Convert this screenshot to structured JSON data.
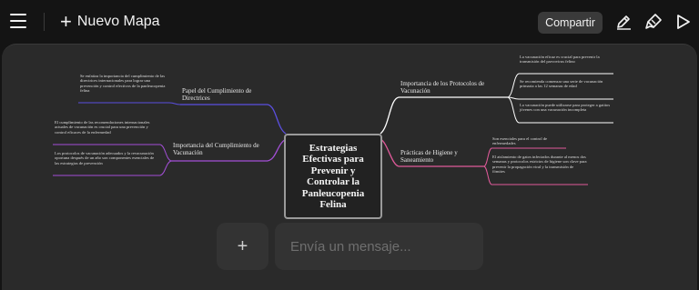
{
  "header": {
    "menu_icon": "hamburger-icon",
    "new_map_icon": "plus-icon",
    "new_map_label": "Nuevo Mapa",
    "share_label": "Compartir",
    "tools": [
      "pen-icon",
      "highlighter-icon",
      "play-icon"
    ]
  },
  "mindmap": {
    "central": "Estrategias Efectivas para Prevenir y Controlar la Panleucopenia Felina",
    "right": [
      {
        "label": "Importancia de los Protocolos de Vacunación",
        "color": "#ffffff",
        "leaves": [
          "La vacunación eficaz es crucial para prevenir la transmisión del parvovirus felino",
          "Se recomienda comenzar una serie de vacunación primaria a las 12 semanas de edad",
          "La vacunación puede utilizarse para proteger a gatitos jóvenes con una vacunación incompleta"
        ]
      },
      {
        "label": "Prácticas de Higiene y Saneamiento",
        "color": "#e05a9a",
        "leaves": [
          "Son esenciales para el control de enfermedades",
          "El aislamiento de gatos infectados durante al menos dos semanas y protocolos estrictos de higiene son clave para prevenir la propagación viral y la transmisión de fómites"
        ]
      }
    ],
    "left": [
      {
        "label": "Papel del Cumplimiento de Directrices",
        "color": "#5b4fe0",
        "leaves": [
          "Se enfatiza la importancia del cumplimiento de las directrices internacionales para lograr una prevención y control efectivos de la panleucopenia felina"
        ]
      },
      {
        "label": "Importancia del Cumplimiento de Vacunación",
        "color": "#a44fd8",
        "leaves": [
          "El cumplimiento de las recomendaciones internacionales actuales de vacunación es crucial para una prevención y control eficaces de la enfermedad",
          "Los protocolos de vacunación adecuados y la revacunación oportuna después de un año son componentes esenciales de las estrategias de prevención"
        ]
      }
    ]
  },
  "composer": {
    "add_icon": "plus-icon",
    "add_label": "+",
    "placeholder": "Envía un mensaje..."
  }
}
